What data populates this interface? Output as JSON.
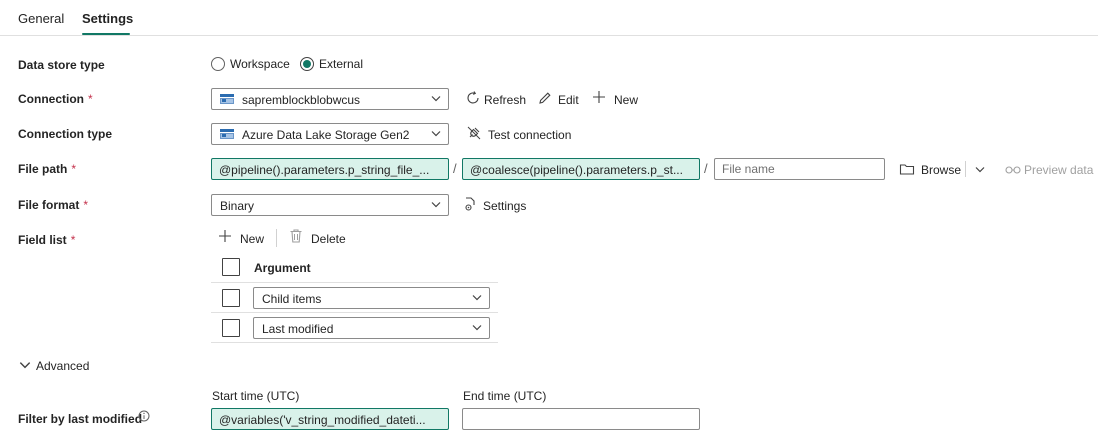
{
  "tabs": [
    {
      "label": "General"
    },
    {
      "label": "Settings"
    }
  ],
  "data_store_type": {
    "label": "Data store type",
    "options": [
      {
        "label": "Workspace"
      },
      {
        "label": "External"
      }
    ],
    "selected": "External"
  },
  "connection": {
    "label": "Connection",
    "required_mark": "*",
    "value": "sapremblockblobwcus",
    "refresh_label": "Refresh",
    "edit_label": "Edit",
    "new_label": "New"
  },
  "connection_type": {
    "label": "Connection type",
    "value": "Azure Data Lake Storage Gen2",
    "test_connection_label": "Test connection"
  },
  "file_path": {
    "label": "File path",
    "required_mark": "*",
    "container_value": "@pipeline().parameters.p_string_file_...",
    "separator": "/",
    "directory_value": "@coalesce(pipeline().parameters.p_st...",
    "file_name_placeholder": "File name",
    "browse_label": "Browse",
    "preview_label": "Preview data"
  },
  "file_format": {
    "label": "File format",
    "required_mark": "*",
    "value": "Binary",
    "settings_label": "Settings"
  },
  "field_list": {
    "label": "Field list",
    "required_mark": "*",
    "new_label": "New",
    "delete_label": "Delete",
    "column_header": "Argument",
    "rows": [
      {
        "value": "Child items"
      },
      {
        "value": "Last modified"
      }
    ]
  },
  "advanced": {
    "label": "Advanced",
    "filter_label": "Filter by last modified",
    "start_time_label": "Start time (UTC)",
    "start_time_value": "@variables('v_string_modified_dateti...",
    "end_time_label": "End time (UTC)",
    "end_time_value": ""
  },
  "colors": {
    "accent": "#117865",
    "dynamic_bg": "#d9f2ea",
    "required": "#c4314b"
  }
}
